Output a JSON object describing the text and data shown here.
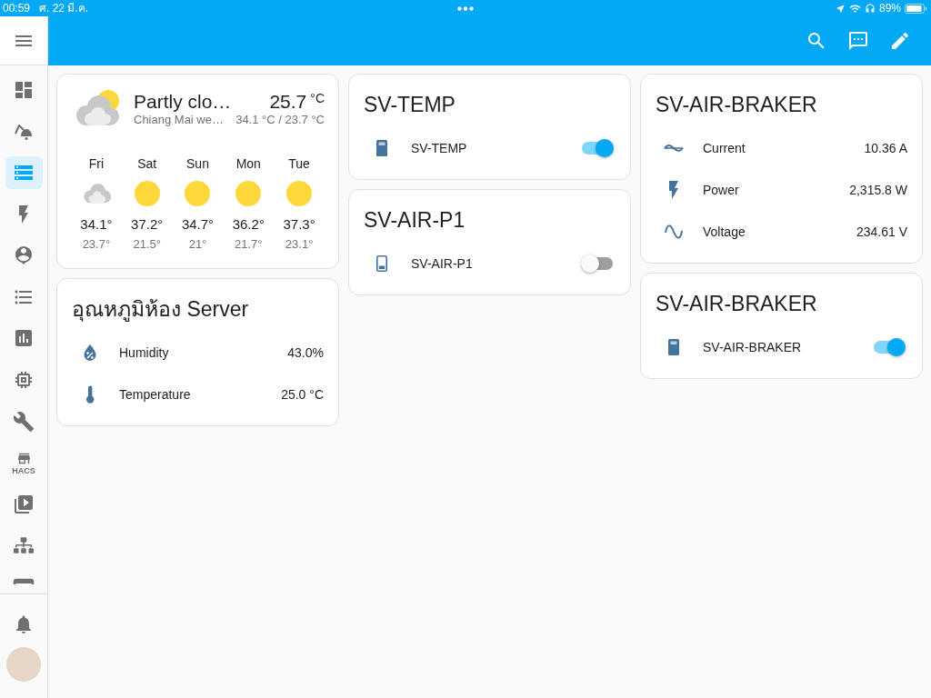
{
  "status_bar": {
    "time": "00:59",
    "date": "ศ. 22 มี.ค.",
    "battery": "89%"
  },
  "sidebar": {
    "items": [
      {
        "selected": false
      },
      {
        "selected": false
      },
      {
        "selected": true
      },
      {
        "selected": false
      },
      {
        "selected": false
      },
      {
        "selected": false
      },
      {
        "selected": false
      },
      {
        "selected": false
      },
      {
        "selected": false
      },
      {
        "selected": false,
        "badge": "HACS"
      },
      {
        "selected": false
      },
      {
        "selected": false
      },
      {
        "selected": false
      }
    ]
  },
  "columns": [
    {
      "cards": [
        {
          "kind": "weather",
          "condition": {
            "kind": "partly-cloudy",
            "text": "Partly clo…"
          },
          "location": "Chiang Mai we…",
          "temperature": "25.7",
          "unit": "°C",
          "high_low": "34.1 °C / 23.7 °C",
          "forecast": [
            {
              "day": "Fri",
              "kind": "cloudy",
              "high": "34.1°",
              "low": "23.7°"
            },
            {
              "day": "Sat",
              "kind": "sunny",
              "high": "37.2°",
              "low": "21.5°"
            },
            {
              "day": "Sun",
              "kind": "sunny",
              "high": "34.7°",
              "low": "21°"
            },
            {
              "day": "Mon",
              "kind": "sunny",
              "high": "36.2°",
              "low": "21.7°"
            },
            {
              "day": "Tue",
              "kind": "sunny",
              "high": "37.3°",
              "low": "23.1°"
            }
          ]
        },
        {
          "kind": "entities",
          "title": "อุณหภูมิห้อง Server",
          "rows": [
            {
              "kind": "humidity",
              "name": "Humidity",
              "value": "43.0%"
            },
            {
              "kind": "temperature",
              "name": "Temperature",
              "value": "25.0 °C"
            }
          ]
        }
      ]
    },
    {
      "cards": [
        {
          "kind": "entities",
          "title": "SV-TEMP",
          "rows": [
            {
              "kind": "switch",
              "name": "SV-TEMP",
              "on": true
            }
          ]
        },
        {
          "kind": "entities",
          "title": "SV-AIR-P1",
          "rows": [
            {
              "kind": "switch",
              "name": "SV-AIR-P1",
              "on": false
            }
          ]
        }
      ]
    },
    {
      "cards": [
        {
          "kind": "entities",
          "title": "SV-AIR-BRAKER",
          "rows": [
            {
              "kind": "current",
              "name": "Current",
              "value": "10.36 A"
            },
            {
              "kind": "power",
              "name": "Power",
              "value": "2,315.8 W"
            },
            {
              "kind": "voltage",
              "name": "Voltage",
              "value": "234.61 V"
            }
          ]
        },
        {
          "kind": "entities",
          "title": "SV-AIR-BRAKER",
          "rows": [
            {
              "kind": "switch",
              "name": "SV-AIR-BRAKER",
              "on": true
            }
          ]
        }
      ]
    }
  ]
}
